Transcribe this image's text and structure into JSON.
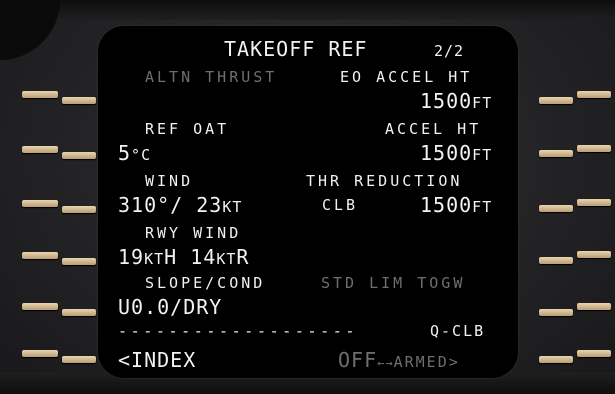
{
  "page": {
    "title": "TAKEOFF REF",
    "page_no": "2/2"
  },
  "rows": {
    "l1_label": "ALTN THRUST",
    "r1_label": "EO ACCEL HT",
    "r1_value": "1500",
    "r1_unit": "FT",
    "l2_label": "REF OAT",
    "r2_label": "ACCEL HT",
    "l2_value": "5",
    "l2_unit": "°C",
    "r2_value": "1500",
    "r2_unit": "FT",
    "l3_label": "WIND",
    "r3_label": "THR REDUCTION",
    "l3_value": "310°/ 23",
    "l3_unit": "KT",
    "c3_value": "CLB",
    "r3_value": "1500",
    "r3_unit": "FT",
    "l4_label": "RWY WIND",
    "l4_value_a": "19",
    "l4_unit_a": "KT",
    "l4_value_b": "H 14",
    "l4_unit_b": "KT",
    "l4_value_c": "R",
    "l5_label": "SLOPE/COND",
    "r5_label": "STD LIM TOGW",
    "l5_value": "U0.0/DRY",
    "divider": "-------------------",
    "r6_label": "Q-CLB",
    "l6_action": "<INDEX",
    "r6_action_off": "OFF",
    "r6_action_arrow": "←→",
    "r6_action_armed": "ARMED>"
  }
}
